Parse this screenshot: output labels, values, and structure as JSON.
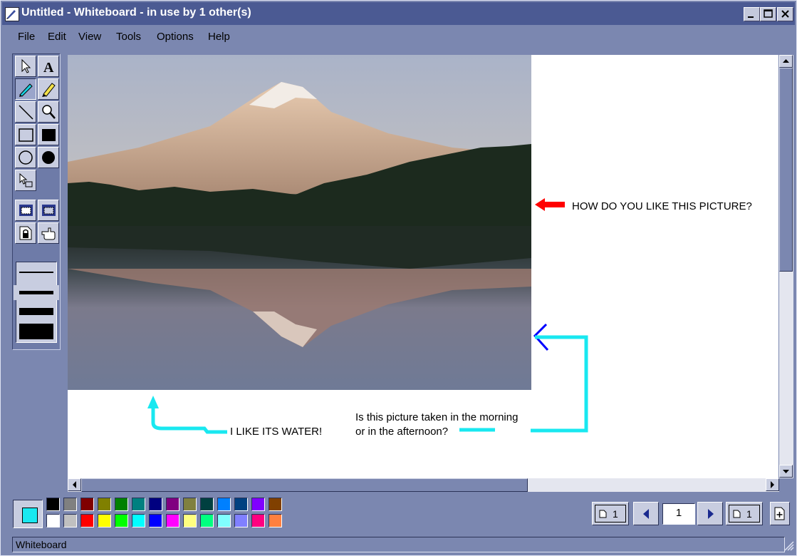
{
  "window": {
    "title": "Untitled - Whiteboard - in use by 1 other(s)"
  },
  "menu": {
    "items": [
      {
        "label": "File"
      },
      {
        "label": "Edit"
      },
      {
        "label": "View"
      },
      {
        "label": "Tools"
      },
      {
        "label": "Options"
      },
      {
        "label": "Help"
      }
    ]
  },
  "tools": [
    {
      "name": "select-arrow-icon"
    },
    {
      "name": "text-tool-icon"
    },
    {
      "name": "pen-icon",
      "active": true
    },
    {
      "name": "highlighter-icon"
    },
    {
      "name": "line-icon"
    },
    {
      "name": "zoom-icon"
    },
    {
      "name": "unfilled-rectangle-icon"
    },
    {
      "name": "filled-rectangle-icon"
    },
    {
      "name": "unfilled-ellipse-icon"
    },
    {
      "name": "filled-ellipse-icon"
    },
    {
      "name": "select-area-icon"
    },
    {
      "name": "select-window-icon"
    },
    {
      "name": "select-area-alt-icon"
    },
    {
      "name": "lock-contents-icon"
    },
    {
      "name": "remote-pointer-icon"
    }
  ],
  "canvas": {
    "annotations": {
      "question1": "HOW DO YOU LIKE THIS PICTURE?",
      "answer1": "I LIKE ITS WATER!",
      "question2_line1": "Is this picture taken in the morning",
      "question2_line2": "or in the afternoon?"
    },
    "colors": {
      "red_arrow": "#ff0000",
      "cyan_arrow": "#19e8f0",
      "blue_arrow": "#0000ff"
    }
  },
  "palette": {
    "current_color": "#19e8f0",
    "row1": [
      "#000000",
      "#808080",
      "#800000",
      "#808000",
      "#008000",
      "#008080",
      "#000080",
      "#800080",
      "#808040",
      "#004040",
      "#0080ff",
      "#004080",
      "#8000ff",
      "#804000"
    ],
    "row2": [
      "#ffffff",
      "#c0c0c0",
      "#ff0000",
      "#ffff00",
      "#00ff00",
      "#00ffff",
      "#0000ff",
      "#ff00ff",
      "#ffff80",
      "#00ff80",
      "#80ffff",
      "#8080ff",
      "#ff0080",
      "#ff8040"
    ]
  },
  "pages": {
    "current_page": "1",
    "first_page_label": "1",
    "last_page_label": "1"
  },
  "status": {
    "text": "Whiteboard"
  }
}
